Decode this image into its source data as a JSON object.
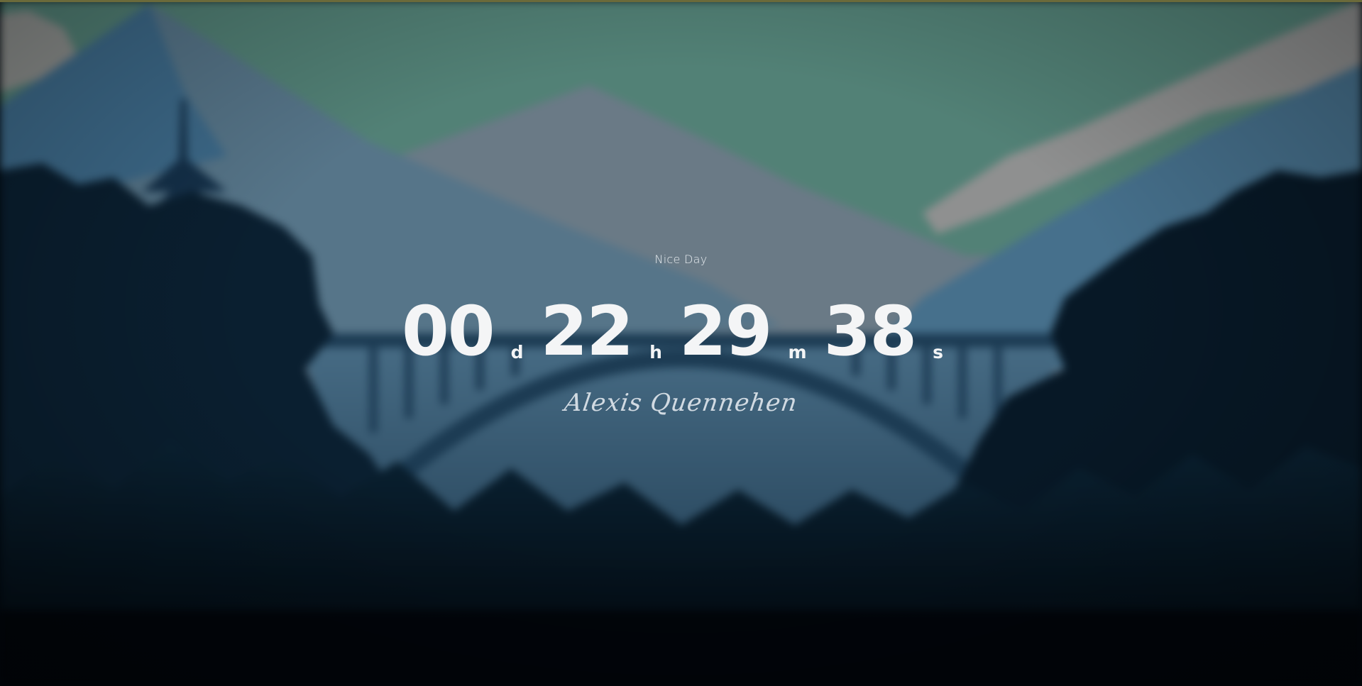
{
  "greeting": "Nice Day",
  "countdown": {
    "days": "00",
    "days_suffix": "d",
    "hours": "22",
    "hours_suffix": "h",
    "minutes": "29",
    "minutes_suffix": "m",
    "seconds": "38",
    "seconds_suffix": "s"
  },
  "signature": "Alexis Quennehen",
  "colors": {
    "sky": "#528176",
    "text": "#f4f5f6",
    "forest": "#02080f"
  }
}
